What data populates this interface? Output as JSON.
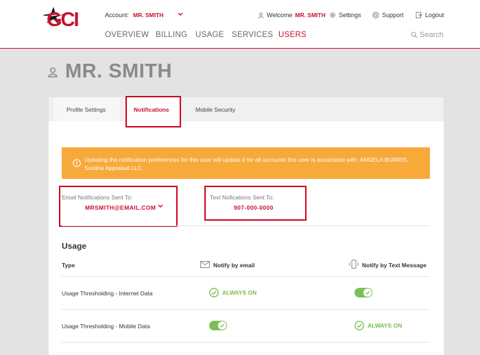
{
  "colors": {
    "brand": "#c8102e",
    "alert": "#f7a93a",
    "toggle_on": "#7cbf58",
    "always_on": "#78bd4b",
    "highlight_box": "#d0021b"
  },
  "header": {
    "logo_text": "GCI",
    "account_label": "Account:",
    "account_value": "MR. SMITH",
    "welcome_label": "Welcome",
    "welcome_name": "MR. SMITH",
    "settings_label": "Settings",
    "support_label": "Support",
    "logout_label": "Logout",
    "search_placeholder": "Search",
    "nav": [
      "OVERVIEW",
      "BILLING",
      "USAGE",
      "SERVICES",
      "USERS"
    ],
    "active_nav": "USERS"
  },
  "page": {
    "title": "MR. SMITH"
  },
  "tabs": [
    "Profile Settings",
    "Notifications",
    "Mobile Security"
  ],
  "active_tab": "Notifications",
  "alert": {
    "icon": "info-icon",
    "text": "Updating the notification preferences for this user will update it for all accounts this user is associated with: ANGELA BURRIS, Susitna Appraisal LLC"
  },
  "email": {
    "label": "Email Notifications Sent To:",
    "value": "MRSMITH@EMAIL.COM"
  },
  "text_notif": {
    "label": "Text Nofications Sent To:",
    "value": "907-000-0000"
  },
  "usage": {
    "title": "Usage",
    "columns": {
      "type": "Type",
      "email": "Notify by email",
      "text": "Notify by Text Message"
    },
    "always_on_label": "ALWAYS ON",
    "rows": [
      {
        "label": "Usage Thresholding - Internet Data",
        "email": "always_on",
        "text": "on"
      },
      {
        "label": "Usage Thresholding - Mobile Data",
        "email": "on",
        "text": "always_on"
      }
    ]
  }
}
